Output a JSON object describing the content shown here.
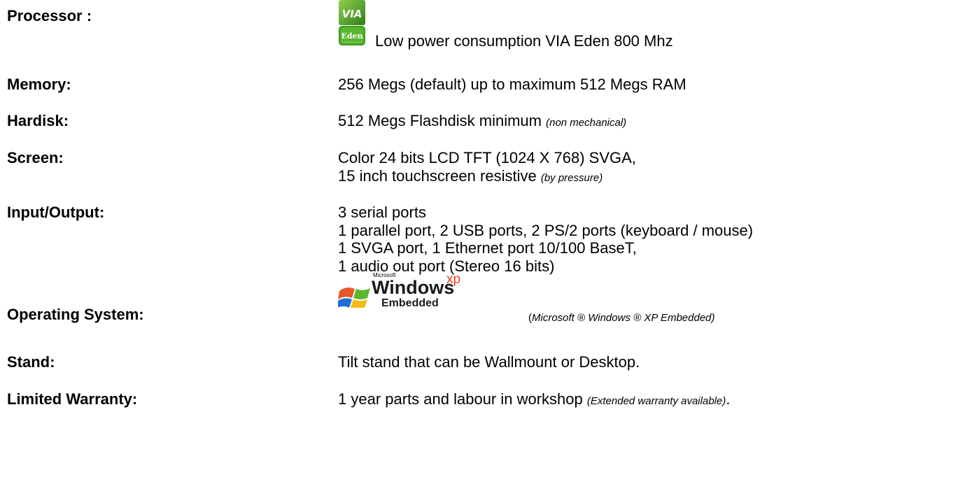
{
  "specs": {
    "processor": {
      "label": "Processor :",
      "logo_text": "Eden",
      "value": "Low power consumption VIA Eden 800 Mhz"
    },
    "memory": {
      "label": "Memory:",
      "value": "256 Megs (default) up to  maximum 512 Megs RAM"
    },
    "hardisk": {
      "label": "Hardisk:",
      "value": "512 Megs Flashdisk minimum",
      "note": "(non mechanical)"
    },
    "screen": {
      "label": "Screen:",
      "line1": "Color 24 bits LCD TFT (1024 X 768) SVGA,",
      "line2": "15 inch touchscreen resistive",
      "note": "(by pressure)"
    },
    "io": {
      "label": "Input/Output:",
      "lines": [
        "3 serial ports",
        "1 parallel port, 2 USB ports, 2 PS/2 ports (keyboard / mouse)",
        "1 SVGA port, 1 Ethernet port 10/100 BaseT,",
        "1 audio out port (Stereo 16 bits)"
      ]
    },
    "os": {
      "label": "Operating System:",
      "logo_brand": "Microsoft",
      "logo_name": "Windows",
      "logo_xp": "xp",
      "logo_sub": "Embedded",
      "note_open": "(",
      "note": "Microsoft ® Windows ® XP Embedded)"
    },
    "stand": {
      "label": "Stand:",
      "value": "Tilt stand that can be Wallmount or Desktop."
    },
    "warranty": {
      "label": "Limited Warranty:",
      "value": "1 year parts and labour in workshop",
      "note": "(Extended warranty available)",
      "end": "."
    }
  },
  "colors": {
    "via_green": "#5aa02c",
    "via_dark": "#2f6e14",
    "xp_red": "#e9421c",
    "xp_green": "#5cb82f",
    "xp_blue": "#1f6fd1",
    "xp_yellow": "#f6b915",
    "xp_orange": "#e8562a"
  }
}
